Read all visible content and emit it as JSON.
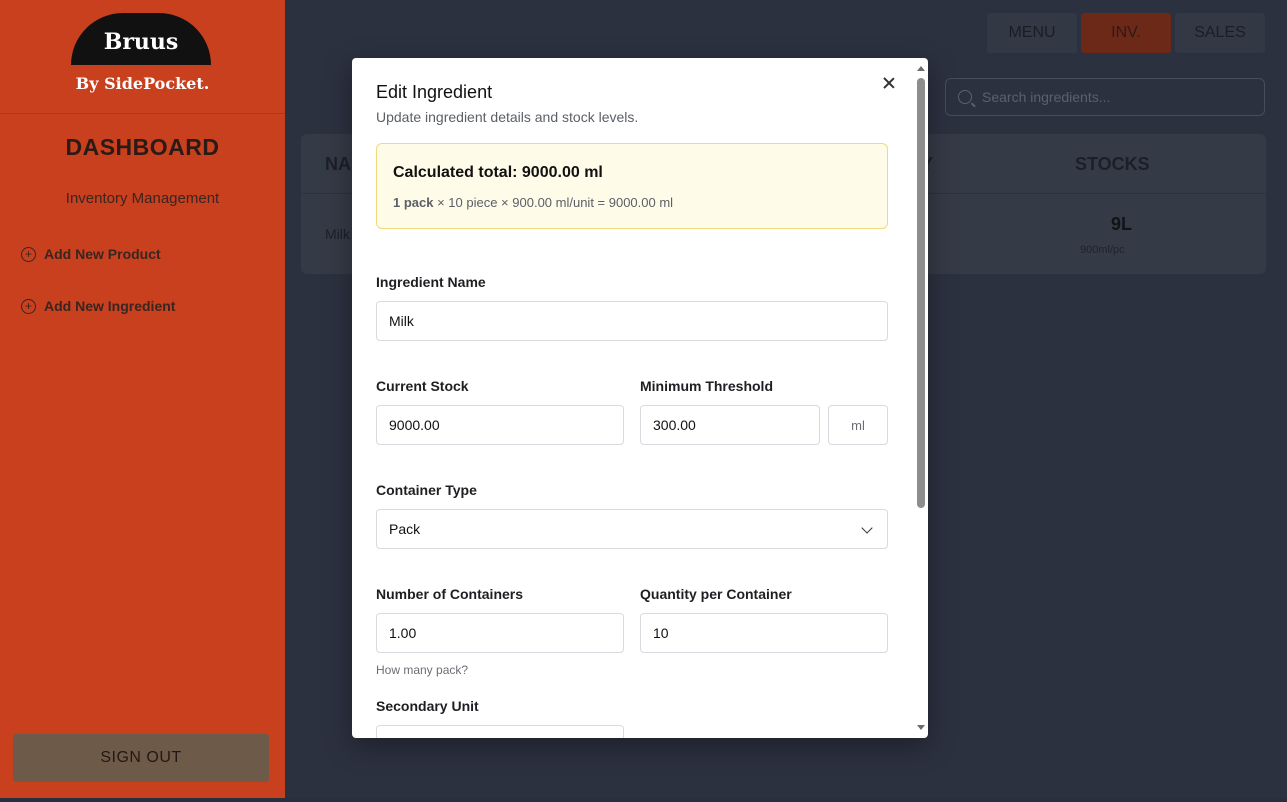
{
  "sidebar": {
    "logo_text": "Bruus",
    "logo_sub": "By SidePocket.",
    "title": "DASHBOARD",
    "subtitle": "Inventory Management",
    "links": [
      {
        "label": "Add New Product",
        "icon": "plus-circle-icon"
      },
      {
        "label": "Add New Ingredient",
        "icon": "plus-circle-icon"
      }
    ],
    "signout_label": "SIGN OUT"
  },
  "nav": {
    "items": [
      "MENU",
      "INV.",
      "SALES"
    ],
    "active": "INV."
  },
  "search": {
    "placeholder": "Search ingredients..."
  },
  "table": {
    "headers": {
      "name": "NA",
      "partial": "Y",
      "stocks": "STOCKS"
    },
    "rows": [
      {
        "name": "Milk",
        "stock": "9L",
        "stock_sub": "900ml/pc"
      }
    ]
  },
  "modal": {
    "title": "Edit Ingredient",
    "description": "Update ingredient details and stock levels.",
    "calc_title": "Calculated total: 9000.00 ml",
    "calc_formula_bold": "1 pack",
    "calc_formula_rest": " × 10 piece × 900.00 ml/unit = 9000.00 ml",
    "fields": {
      "ingredient_name_label": "Ingredient Name",
      "ingredient_name_value": "Milk",
      "current_stock_label": "Current Stock",
      "current_stock_value": "9000.00",
      "min_threshold_label": "Minimum Threshold",
      "min_threshold_value": "300.00",
      "unit": "ml",
      "container_type_label": "Container Type",
      "container_type_value": "Pack",
      "num_containers_label": "Number of Containers",
      "num_containers_value": "1.00",
      "num_containers_hint": "How many pack?",
      "qty_per_container_label": "Quantity per Container",
      "qty_per_container_value": "10",
      "secondary_unit_label": "Secondary Unit"
    }
  },
  "colors": {
    "sidebar": "#c8401e",
    "accent_active": "#6d2918",
    "calc_bg": "#fefbe8",
    "calc_border": "#f2d97a"
  }
}
